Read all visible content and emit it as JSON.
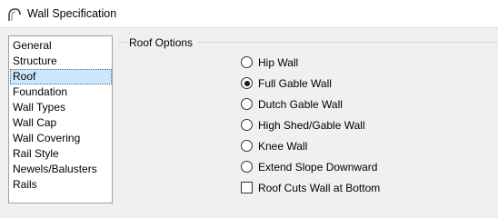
{
  "window": {
    "title": "Wall Specification",
    "icon": "arch-icon"
  },
  "nav": {
    "items": [
      {
        "label": "General",
        "selected": false
      },
      {
        "label": "Structure",
        "selected": false
      },
      {
        "label": "Roof",
        "selected": true
      },
      {
        "label": "Foundation",
        "selected": false
      },
      {
        "label": "Wall Types",
        "selected": false
      },
      {
        "label": "Wall Cap",
        "selected": false
      },
      {
        "label": "Wall Covering",
        "selected": false
      },
      {
        "label": "Rail Style",
        "selected": false
      },
      {
        "label": "Newels/Balusters",
        "selected": false
      },
      {
        "label": "Rails",
        "selected": false
      }
    ]
  },
  "roof_options": {
    "group_label": "Roof Options",
    "radios": [
      {
        "label": "Hip Wall",
        "checked": false
      },
      {
        "label": "Full Gable Wall",
        "checked": true
      },
      {
        "label": "Dutch Gable Wall",
        "checked": false
      },
      {
        "label": "High Shed/Gable Wall",
        "checked": false
      },
      {
        "label": "Knee Wall",
        "checked": false
      },
      {
        "label": "Extend Slope Downward",
        "checked": false
      }
    ],
    "checkbox": {
      "label": "Roof Cuts Wall at Bottom",
      "checked": false
    }
  }
}
